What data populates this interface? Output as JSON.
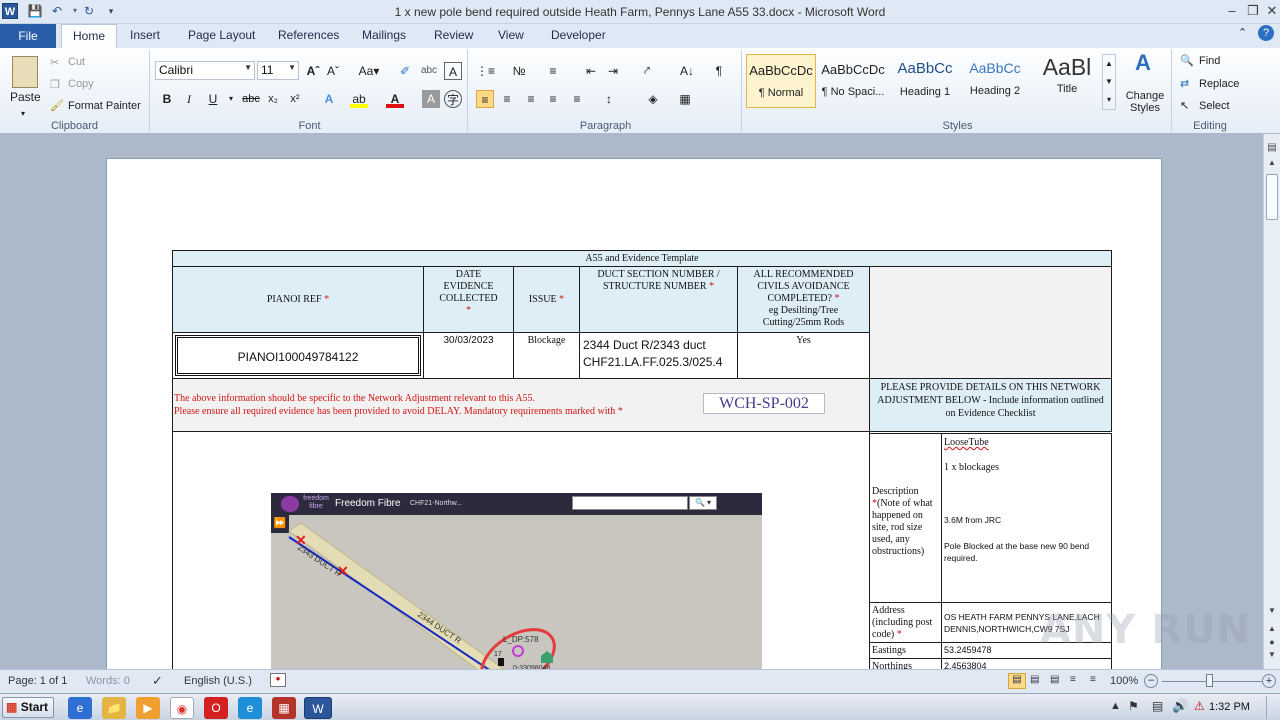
{
  "window": {
    "title": "1 x new pole bend required outside Heath Farm, Pennys Lane A55 33.docx - Microsoft Word",
    "app_icon": "W"
  },
  "tabs": [
    "File",
    "Home",
    "Insert",
    "Page Layout",
    "References",
    "Mailings",
    "Review",
    "View",
    "Developer"
  ],
  "ribbon": {
    "clipboard": {
      "paste": "Paste",
      "cut": "Cut",
      "copy": "Copy",
      "format_painter": "Format Painter",
      "label": "Clipboard"
    },
    "font": {
      "name": "Calibri",
      "size": "11",
      "label": "Font"
    },
    "paragraph": {
      "label": "Paragraph"
    },
    "styles": {
      "items": [
        {
          "preview": "AaBbCcDc",
          "name": "¶ Normal"
        },
        {
          "preview": "AaBbCcDc",
          "name": "¶ No Spaci..."
        },
        {
          "preview": "AaBbCc",
          "name": "Heading 1"
        },
        {
          "preview": "AaBbCc",
          "name": "Heading 2"
        },
        {
          "preview": "AaBl",
          "name": "Title"
        }
      ],
      "change_styles": "Change Styles",
      "label": "Styles"
    },
    "editing": {
      "find": "Find",
      "replace": "Replace",
      "select": "Select",
      "label": "Editing"
    }
  },
  "doc": {
    "template_title": "A55 and Evidence Template",
    "headers": {
      "pianoi_ref": "PIANOI REF",
      "date_evidence": "DATE EVIDENCE COLLECTED",
      "issue": "ISSUE",
      "duct_section": "DUCT SECTION NUMBER / STRUCTURE NUMBER",
      "civils": "ALL RECOMMENDED CIVILS AVOIDANCE COMPLETED?",
      "civils_eg": "eg Desilting/Tree Cutting/25mm Rods"
    },
    "values": {
      "pianoi_ref": "PIANOI100049784122",
      "date": "30/03/2023",
      "issue": "Blockage",
      "duct_line1": "2344 Duct R/2343 duct",
      "duct_line2": "CHF21.LA.FF.025.3/025.4",
      "civils": "Yes"
    },
    "notice1": "The above information should be specific to the Network Adjustment relevant to this A55.",
    "notice2": "Please ensure all required evidence has been provided to avoid DELAY.  Mandatory requirements marked with",
    "ref_code": "WCH-SP-002",
    "details_header": "PLEASE PROVIDE DETAILS ON THIS NETWORK ADJUSTMENT BELOW - Include information outlined on Evidence Checklist",
    "description_label": "Description",
    "description_note": "(Note of what happened on site, rod size used, any obstructions)",
    "description_lines": [
      "LooseTube",
      "1 x blockages",
      "3.6M from JRC",
      "Pole Blocked at the base new 90 bend required."
    ],
    "address_label": "Address (including post code)",
    "address_value": "OS HEATH FARM PENNYS LANE,LACH DENNIS,NORTHWICH,CW9 7SJ",
    "eastings_label": "Eastings",
    "eastings_value": "53.2459478",
    "northings_label": "Northings",
    "northings_value": "2.4563804",
    "map": {
      "brand": "freedom fibre",
      "app_title": "Freedom Fibre",
      "layer": "CHF21-Northw...",
      "duct_label1": "2343 DUCT R",
      "duct_label2": "2344 DUCT R",
      "dp_label": "L_DP:578",
      "coord_label": "0-33098048",
      "num_label": "17"
    },
    "mandatory_mark": "*"
  },
  "statusbar": {
    "page": "Page: 1 of 1",
    "words": "Words: 0",
    "language": "English (U.S.)",
    "zoom": "100%"
  },
  "taskbar": {
    "start": "Start",
    "time": "1:32 PM"
  },
  "watermark": "ANY RUN"
}
